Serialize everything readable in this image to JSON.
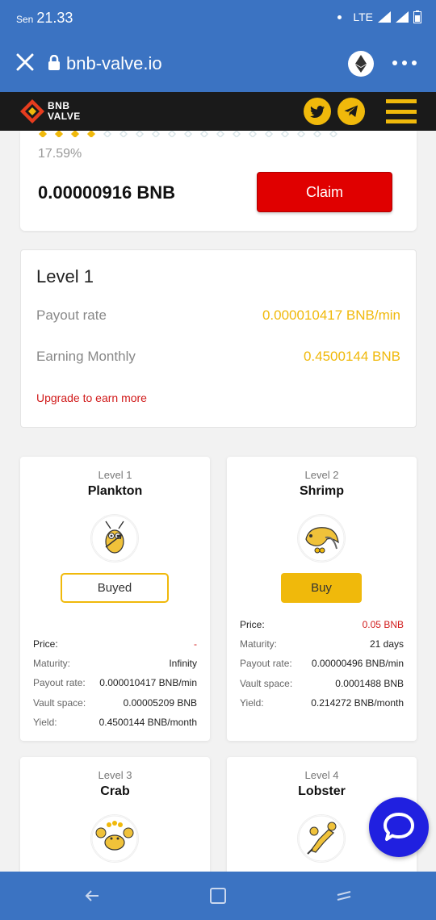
{
  "status_bar": {
    "day": "Sen",
    "time": "21.33",
    "network": "LTE"
  },
  "browser": {
    "url": "bnb-valve.io"
  },
  "site": {
    "logo_line1": "BNB",
    "logo_line2": "VALVE"
  },
  "claim": {
    "percent": "17.59%",
    "amount": "0.00000916 BNB",
    "button_label": "Claim"
  },
  "level_info": {
    "title": "Level 1",
    "payout_label": "Payout rate",
    "payout_value": "0.000010417 BNB/min",
    "monthly_label": "Earning Monthly",
    "monthly_value": "0.4500144 BNB",
    "upgrade_link": "Upgrade to earn more"
  },
  "labels": {
    "price": "Price:",
    "maturity": "Maturity:",
    "payout_rate": "Payout rate:",
    "vault_space": "Vault space:",
    "yield": "Yield:"
  },
  "plans": [
    {
      "level": "Level 1",
      "name": "Plankton",
      "button": "Buyed",
      "price": "-",
      "maturity": "Infinity",
      "payout": "0.000010417 BNB/min",
      "vault": "0.00005209 BNB",
      "yield": "0.4500144 BNB/month"
    },
    {
      "level": "Level 2",
      "name": "Shrimp",
      "button": "Buy",
      "price": "0.05 BNB",
      "maturity": "21 days",
      "payout": "0.00000496 BNB/min",
      "vault": "0.0001488 BNB",
      "yield": "0.214272 BNB/month"
    },
    {
      "level": "Level 3",
      "name": "Crab"
    },
    {
      "level": "Level 4",
      "name": "Lobster"
    }
  ],
  "colors": {
    "browser_blue": "#3b73c2",
    "brand_yellow": "#f0b90b",
    "claim_red": "#e00000",
    "header_dark": "#1a1a1a"
  }
}
